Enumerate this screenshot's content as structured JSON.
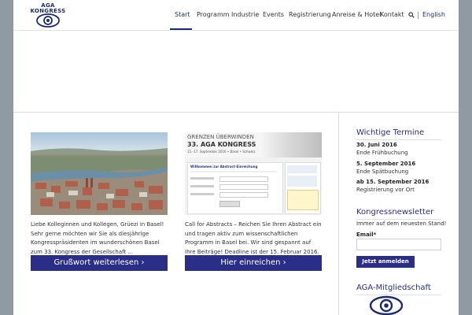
{
  "header": {
    "logo_text_line1": "AGA",
    "logo_text_line2": "KONGRESS",
    "nav": [
      "Start",
      "Programm",
      "Industrie",
      "Events",
      "Registrierung",
      "Anreise & Hotel",
      "Kontakt"
    ],
    "lang": "English"
  },
  "colors": {
    "brand": "#2b2e86",
    "background": "#8f9aa2"
  },
  "main": {
    "welcome_text": "Liebe Kolleginnen und Kollegen, Grüezi in Basel! Sehr gerne möchten wir Sie als diesjährige Kongresspräsidenten im wunderschönen Basel zum 33. Kongress der Gesellschaft ...",
    "welcome_button": "Grußwort weiterlesen ›",
    "abstract_text": "Call for Abstracts – Reichen Sie Ihren Abstract ein und tragen aktiv zum wissenschaftlichen Programm in Basel bei. Wir sind gespannt auf Ihre Beiträge! Deadline ist der 15. Februar 2016.",
    "abstract_button": "Hier einreichen ›",
    "abstract_image": {
      "line1": "GRENZEN ÜBERWINDEN",
      "line2": "33. AGA KONGRESS",
      "line3": "15.–17. September 2016 • Basel • Schweiz",
      "form_title": "Willkommen zur Abstract-Einreichung"
    }
  },
  "sidebar": {
    "termine_title": "Wichtige Termine",
    "termine": [
      {
        "date": "30. Juni 2016",
        "desc": "Ende Frühbuchung"
      },
      {
        "date": "5. September 2016",
        "desc": "Ende Spätbuchung"
      },
      {
        "date": "ab 15. September 2016",
        "desc": "Registrierung vor Ort"
      }
    ],
    "newsletter_title": "Kongressnewsletter",
    "newsletter_text": "Immer auf dem neuesten Stand!",
    "email_label": "Email*",
    "subscribe_button": "Jetzt anmelden",
    "membership_title": "AGA-Mitgliedschaft"
  }
}
